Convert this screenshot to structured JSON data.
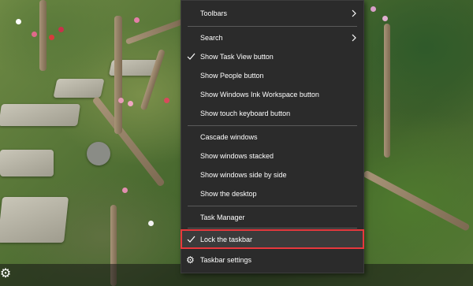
{
  "context_menu": {
    "items": [
      {
        "label": "Toolbars",
        "submenu": true
      },
      {
        "label": "Search",
        "submenu": true
      },
      {
        "label": "Show Task View button",
        "checked": true
      },
      {
        "label": "Show People button"
      },
      {
        "label": "Show Windows Ink Workspace button"
      },
      {
        "label": "Show touch keyboard button"
      },
      {
        "label": "Cascade windows"
      },
      {
        "label": "Show windows stacked"
      },
      {
        "label": "Show windows side by side"
      },
      {
        "label": "Show the desktop"
      },
      {
        "label": "Task Manager"
      },
      {
        "label": "Lock the taskbar",
        "checked": true,
        "highlighted": true
      },
      {
        "label": "Taskbar settings",
        "icon": "gear-icon"
      }
    ]
  },
  "colors": {
    "menu_bg": "#2b2b2b",
    "menu_text": "#ffffff",
    "separator": "#5a5a5a",
    "highlight_border": "#e8383d"
  },
  "taskbar": {
    "settings_icon": "gear-icon"
  }
}
